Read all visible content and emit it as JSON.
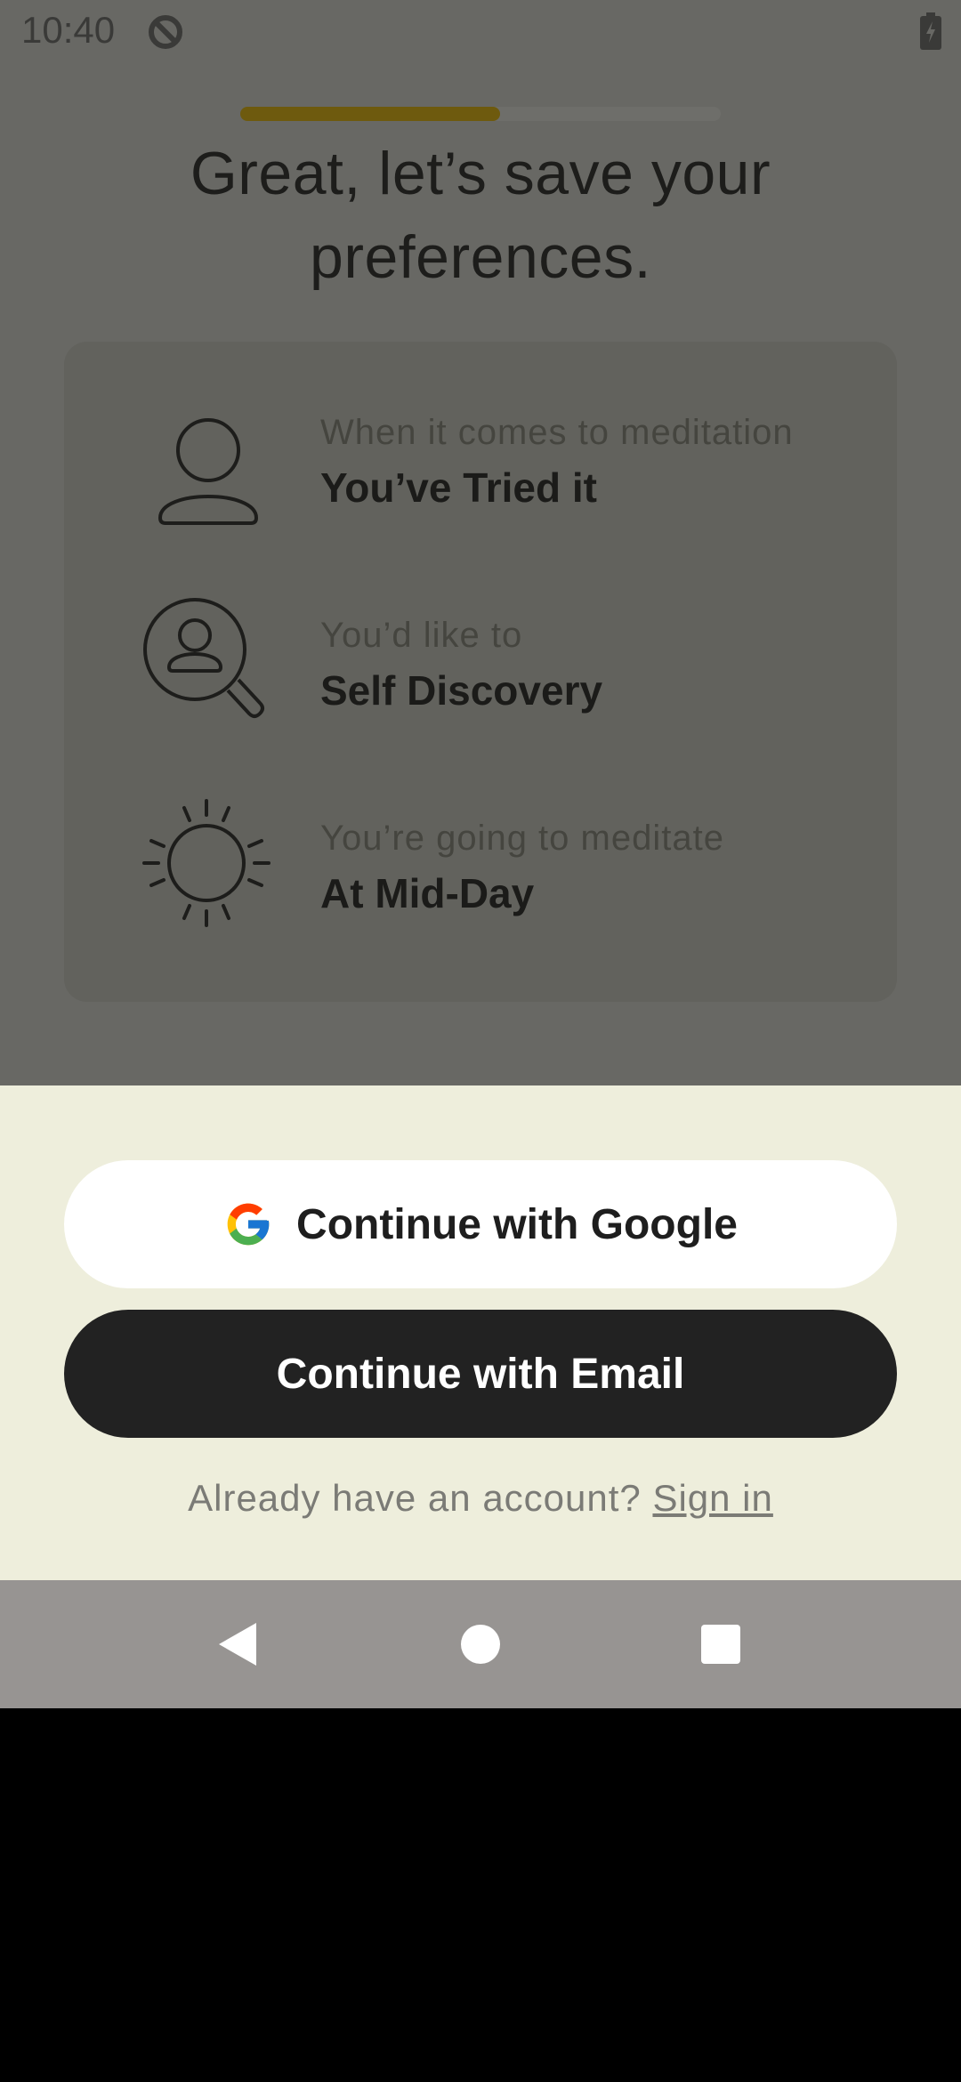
{
  "status_bar": {
    "time": "10:40",
    "icons": [
      "sync-circle-icon",
      "battery-charging-icon"
    ]
  },
  "progress": {
    "fraction": 0.54
  },
  "title": "Great, let’s save your preferences.",
  "preferences": [
    {
      "icon": "person-icon",
      "label": "When it comes to meditation",
      "value": "You’ve Tried it"
    },
    {
      "icon": "person-search-icon",
      "label": "You’d like to",
      "value": "Self Discovery"
    },
    {
      "icon": "sun-icon",
      "label": "You’re going to meditate",
      "value": "At Mid-Day"
    }
  ],
  "sheet": {
    "google_button": "Continue with Google",
    "email_button": "Continue with Email",
    "signin_prompt": "Already have an account?",
    "signin_link": "Sign in"
  },
  "nav_bar": {
    "icons": [
      "back-icon",
      "home-icon",
      "recents-icon"
    ]
  },
  "colors": {
    "accent_progress": "#6e5a0e",
    "sheet_background": "#eeeedc",
    "email_button": "#222222"
  }
}
